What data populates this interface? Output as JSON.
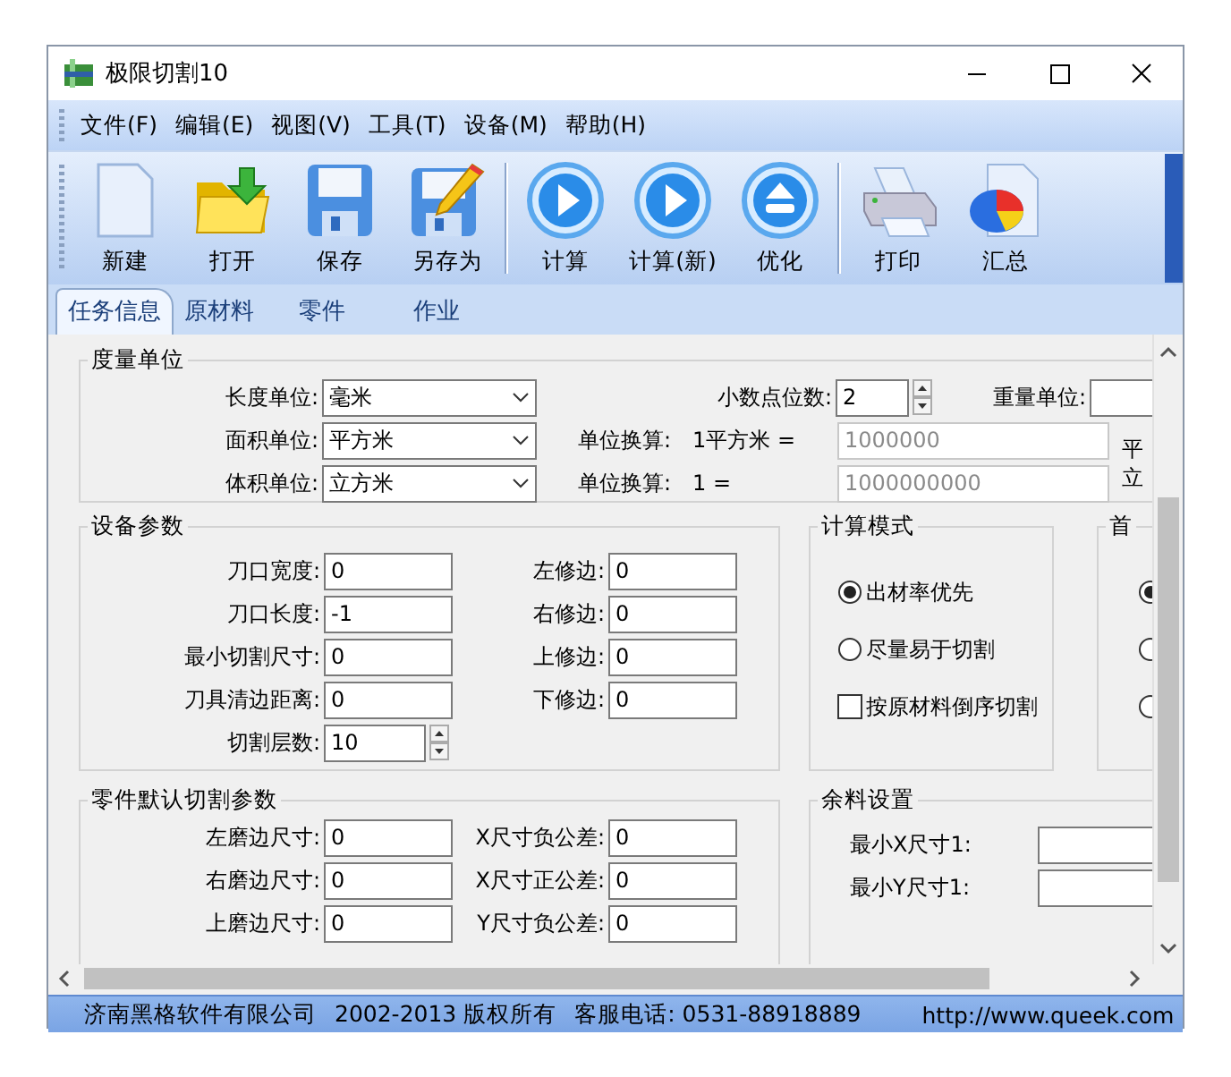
{
  "window": {
    "title": "极限切割10"
  },
  "menu": [
    {
      "label": "文件(F)"
    },
    {
      "label": "编辑(E)"
    },
    {
      "label": "视图(V)"
    },
    {
      "label": "工具(T)"
    },
    {
      "label": "设备(M)"
    },
    {
      "label": "帮助(H)"
    }
  ],
  "toolbar_groups": [
    [
      {
        "label": "新建",
        "kind": "document"
      },
      {
        "label": "打开",
        "kind": "folder"
      },
      {
        "label": "保存",
        "kind": "floppy"
      },
      {
        "label": "另存为",
        "kind": "floppy-pencil"
      }
    ],
    [
      {
        "label": "计算",
        "kind": "play"
      },
      {
        "label": "计算(新)",
        "kind": "play"
      },
      {
        "label": "优化",
        "kind": "eject"
      }
    ],
    [
      {
        "label": "打印",
        "kind": "printer"
      },
      {
        "label": "汇总",
        "kind": "chart-doc"
      }
    ]
  ],
  "tabs": [
    {
      "label": "任务信息",
      "selected": true
    },
    {
      "label": "原材料",
      "selected": false
    },
    {
      "label": "零件",
      "selected": false
    },
    {
      "label": "作业",
      "selected": false
    }
  ],
  "measure_units": {
    "title": "度量单位",
    "units": [
      {
        "label": "长度单位:",
        "value": "毫米"
      },
      {
        "label": "面积单位:",
        "value": "平方米"
      },
      {
        "label": "体积单位:",
        "value": "立方米"
      }
    ],
    "decimal": {
      "label": "小数点位数:",
      "value": "2"
    },
    "weight": {
      "label": "重量单位:"
    },
    "conversions": [
      {
        "label": "单位换算:",
        "unit": "1平方米 =",
        "value": "1000000",
        "suffix": "平"
      },
      {
        "label": "单位换算:",
        "unit": "1 =",
        "value": "1000000000",
        "suffix": "立"
      }
    ]
  },
  "equipment": {
    "title": "设备参数",
    "left": [
      {
        "label": "刀口宽度:",
        "value": "0"
      },
      {
        "label": "刀口长度:",
        "value": "-1"
      },
      {
        "label": "最小切割尺寸:",
        "value": "0"
      },
      {
        "label": "刀具清边距离:",
        "value": "0"
      },
      {
        "label": "切割层数:",
        "value": "10",
        "kind": "spin"
      }
    ],
    "right": [
      {
        "label": "左修边:",
        "value": "0"
      },
      {
        "label": "右修边:",
        "value": "0"
      },
      {
        "label": "上修边:",
        "value": "0"
      },
      {
        "label": "下修边:",
        "value": "0"
      }
    ]
  },
  "calc_mode": {
    "title": "计算模式",
    "options": [
      {
        "label": "出材率优先",
        "kind": "radio",
        "selected": true
      },
      {
        "label": "尽量易于切割",
        "kind": "radio",
        "selected": false
      },
      {
        "label": "按原材料倒序切割",
        "kind": "checkbox",
        "checked": false
      }
    ]
  },
  "first_cut": {
    "title": "首",
    "options": [
      {
        "selected": true
      },
      {
        "selected": false
      },
      {
        "selected": false
      }
    ]
  },
  "part_defaults": {
    "title": "零件默认切割参数",
    "left": [
      {
        "label": "左磨边尺寸:",
        "value": "0"
      },
      {
        "label": "右磨边尺寸:",
        "value": "0"
      },
      {
        "label": "上磨边尺寸:",
        "value": "0"
      }
    ],
    "right": [
      {
        "label": "X尺寸负公差:",
        "value": "0"
      },
      {
        "label": "X尺寸正公差:",
        "value": "0"
      },
      {
        "label": "Y尺寸负公差:",
        "value": "0"
      }
    ]
  },
  "remnant": {
    "title": "余料设置",
    "rows": [
      {
        "label": "最小X尺寸1:"
      },
      {
        "label": "最小Y尺寸1:"
      }
    ]
  },
  "status_bar": [
    "济南黑格软件有限公司",
    "2002-2013 版权所有",
    "客服电话: 0531-88918889",
    "http://www.queek.com"
  ]
}
